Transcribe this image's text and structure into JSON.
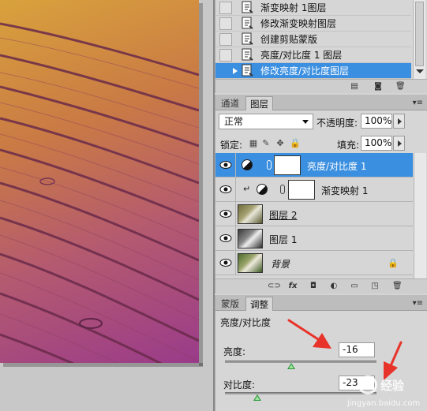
{
  "history": {
    "items": [
      {
        "label": "渐变映射 1图层",
        "selected": false
      },
      {
        "label": "修改渐变映射图层",
        "selected": false
      },
      {
        "label": "创建剪贴蒙版",
        "selected": false
      },
      {
        "label": "亮度/对比度 1 图层",
        "selected": false
      },
      {
        "label": "修改亮度/对比度图层",
        "selected": true
      }
    ]
  },
  "layers_panel": {
    "tabs": [
      {
        "label": "通道",
        "active": false
      },
      {
        "label": "图层",
        "active": true
      }
    ],
    "blend_mode": "正常",
    "opacity_label": "不透明度:",
    "opacity_value": "100%",
    "lock_label": "锁定:",
    "fill_label": "填充:",
    "fill_value": "100%",
    "layers": [
      {
        "name": "亮度/对比度 1",
        "kind": "adjustment",
        "selected": true,
        "clipped": false
      },
      {
        "name": "渐变映射 1",
        "kind": "adjustment",
        "selected": false,
        "clipped": true
      },
      {
        "name": "图层 2",
        "kind": "photo",
        "selected": false
      },
      {
        "name": "图层 1",
        "kind": "photo-gray",
        "selected": false
      },
      {
        "name": "背景",
        "kind": "photo",
        "selected": false,
        "locked": true
      }
    ]
  },
  "adjustments_panel": {
    "tabs": [
      {
        "label": "蒙版",
        "active": false
      },
      {
        "label": "调整",
        "active": true
      }
    ],
    "title": "亮度/对比度",
    "brightness_label": "亮度:",
    "brightness_value": "-16",
    "contrast_label": "对比度:",
    "contrast_value": "-23"
  },
  "watermark": {
    "text": "经验",
    "url": "jingyan.baidu.com"
  },
  "colors": {
    "selection": "#3b8fe0",
    "annotation_arrow": "#e8332a"
  }
}
